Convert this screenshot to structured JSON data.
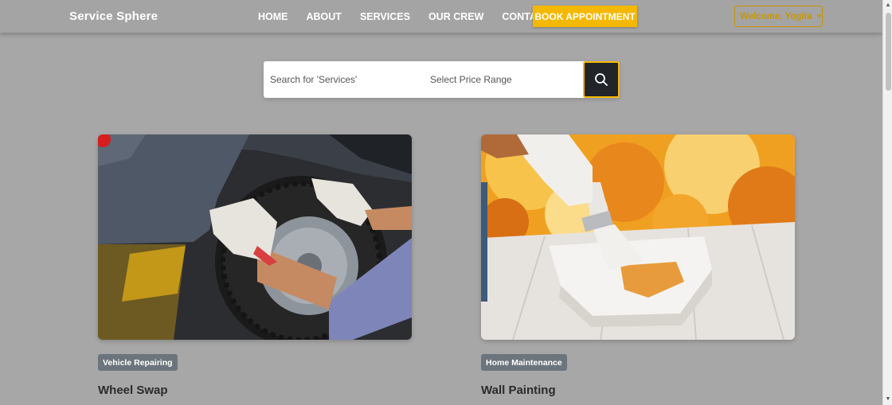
{
  "brand": "Service Sphere",
  "nav": {
    "links": [
      "HOME",
      "ABOUT",
      "SERVICES",
      "OUR CREW",
      "CONTACT"
    ],
    "book_label": "BOOK APPOINTMENT",
    "welcome_label": "Welcome, Yogita"
  },
  "search": {
    "placeholder": "Search for 'Services'",
    "price_label": "Select Price Range"
  },
  "cards": [
    {
      "category": "Vehicle Repairing",
      "title": "Wheel Swap"
    },
    {
      "category": "Home Maintenance",
      "title": "Wall Painting"
    }
  ],
  "colors": {
    "accent": "#f5b800",
    "dark": "#212529",
    "badge": "#6c757d",
    "overlay": "#a7a7a7"
  }
}
